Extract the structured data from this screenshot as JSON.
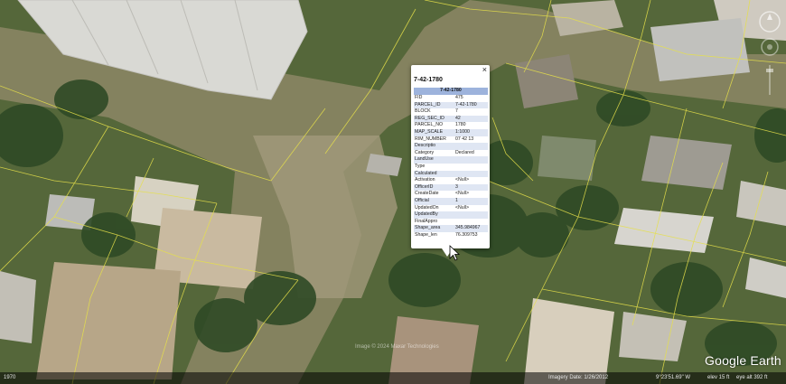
{
  "popup": {
    "close_label": "×",
    "title": "7-42-1780",
    "table_header": "7-42-1780",
    "rows": [
      {
        "key": "FID",
        "value": "475"
      },
      {
        "key": "PARCEL_ID",
        "value": "7-42-1780"
      },
      {
        "key": "BLOCK",
        "value": "7"
      },
      {
        "key": "REG_SEC_ID",
        "value": "42"
      },
      {
        "key": "PARCEL_NO",
        "value": "1780"
      },
      {
        "key": "MAP_SCALE",
        "value": "1:1000"
      },
      {
        "key": "RIM_NUMBER",
        "value": "07 42 13"
      },
      {
        "key": "Descriptio",
        "value": ""
      },
      {
        "key": "Category",
        "value": "Declared"
      },
      {
        "key": "LandUse",
        "value": ""
      },
      {
        "key": "Type",
        "value": ""
      },
      {
        "key": "Calculated",
        "value": ""
      },
      {
        "key": "Activation",
        "value": "<Null>"
      },
      {
        "key": "OfficerID",
        "value": "3"
      },
      {
        "key": "CreateDate",
        "value": "<Null>"
      },
      {
        "key": "Official",
        "value": "1"
      },
      {
        "key": "UpdatedOn",
        "value": "<Null>"
      },
      {
        "key": "UpdatedBy",
        "value": ""
      },
      {
        "key": "FinalAppro",
        "value": ""
      },
      {
        "key": "Shape_area",
        "value": "345.984967"
      },
      {
        "key": "Shape_len",
        "value": "76.309753"
      }
    ]
  },
  "statusbar": {
    "left_label": "1970",
    "imagery_date": "Imagery Date: 1/26/2012",
    "coordinates": "9°23'51.69\" W",
    "elevation": "elev   15 ft",
    "eye_alt": "eye alt   392 ft"
  },
  "brand": "Google Earth",
  "copyright": "Image © 2024 Maxar Technologies"
}
